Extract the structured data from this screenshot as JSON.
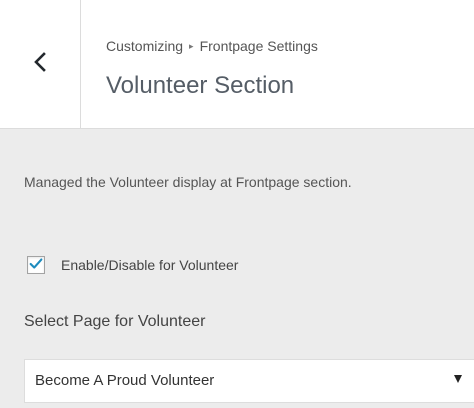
{
  "header": {
    "back_icon": "chevron-left-icon",
    "breadcrumb_root": "Customizing",
    "breadcrumb_separator": "▸",
    "breadcrumb_parent": "Frontpage Settings",
    "title": "Volunteer Section"
  },
  "section": {
    "description": "Managed the Volunteer display at Frontpage section.",
    "enable_checkbox": {
      "label": "Enable/Disable for Volunteer",
      "checked": true
    },
    "page_select": {
      "label": "Select Page for Volunteer",
      "selected": "Become A Proud Volunteer"
    }
  },
  "colors": {
    "accent": "#0073aa",
    "panel_background": "#ececec",
    "header_background": "#ffffff"
  }
}
